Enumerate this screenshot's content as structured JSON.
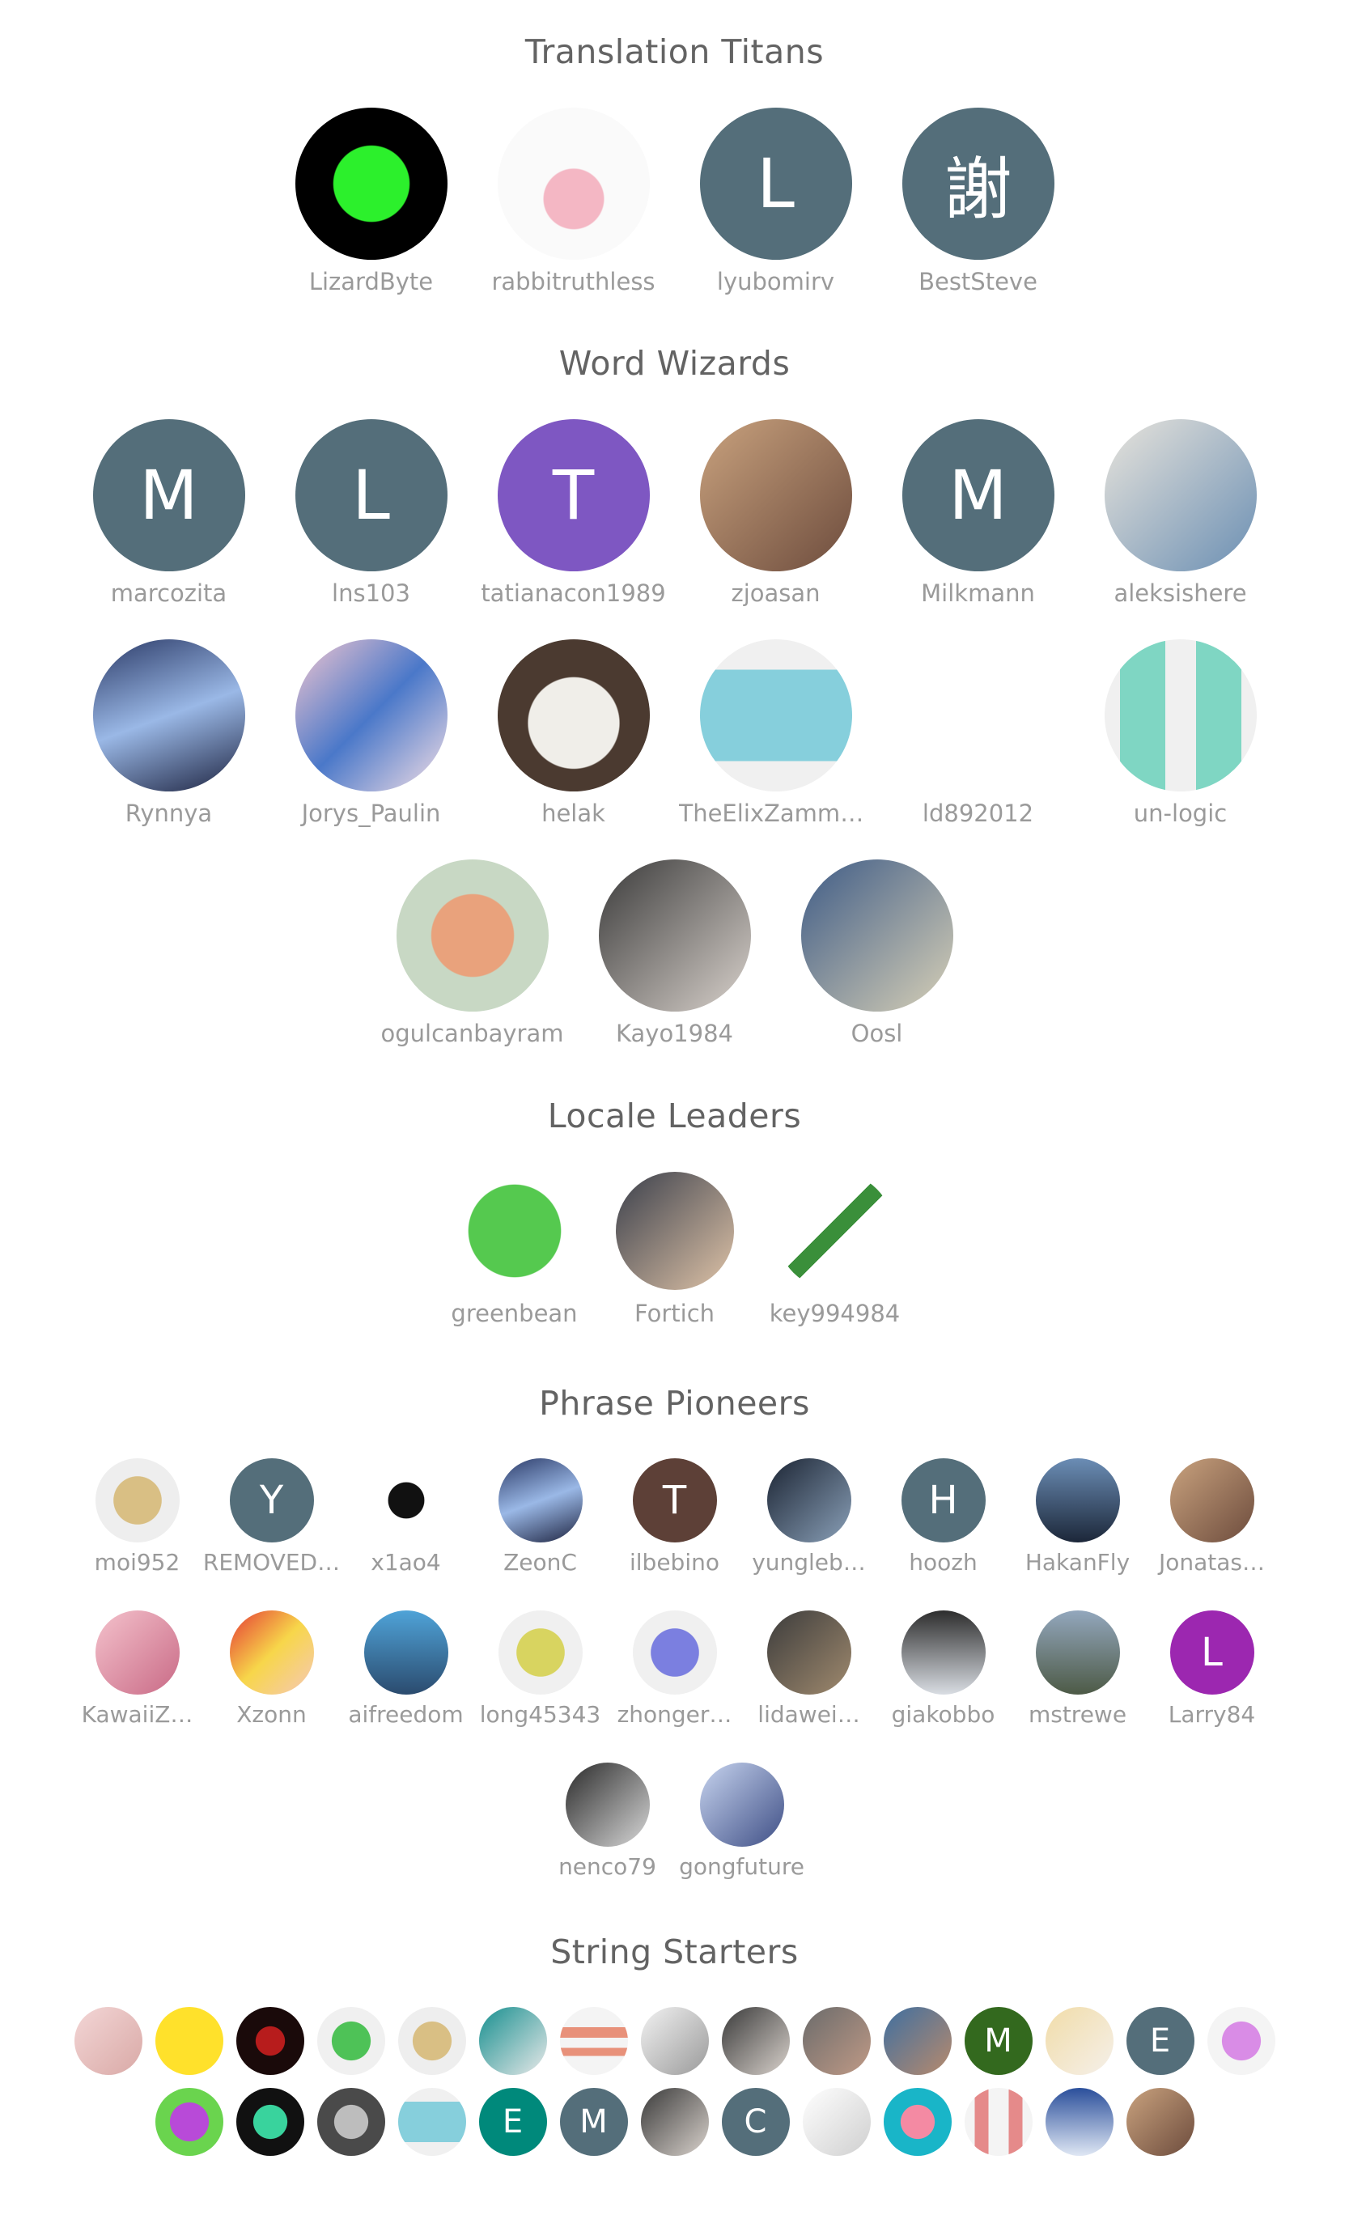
{
  "tiers": [
    {
      "title": "Translation Titans",
      "members": [
        {
          "name": "LizardByte",
          "avatar": "lizard-logo"
        },
        {
          "name": "rabbitruthless",
          "avatar": "rabbit-skull-image"
        },
        {
          "name": "lyubomirv",
          "avatar": "letter",
          "letter": "L",
          "color": "#546e7a"
        },
        {
          "name": "BestSteve",
          "avatar": "letter",
          "letter": "謝",
          "color": "#546e7a"
        }
      ]
    },
    {
      "title": "Word Wizards",
      "members": [
        {
          "name": "marcozita",
          "avatar": "letter",
          "letter": "M",
          "color": "#546e7a"
        },
        {
          "name": "lns103",
          "avatar": "letter",
          "letter": "L",
          "color": "#546e7a"
        },
        {
          "name": "tatianacon1989",
          "avatar": "letter",
          "letter": "T",
          "color": "#7e57c2"
        },
        {
          "name": "zjoasan",
          "avatar": "man-photo"
        },
        {
          "name": "Milkmann",
          "avatar": "letter",
          "letter": "M",
          "color": "#546e7a"
        },
        {
          "name": "aleksishere",
          "avatar": "dog-photo"
        },
        {
          "name": "Rynnya",
          "avatar": "anime-art"
        },
        {
          "name": "Jorys_Paulin",
          "avatar": "cubes-art"
        },
        {
          "name": "helak",
          "avatar": "cat-photo"
        },
        {
          "name": "TheElixZammuto",
          "avatar": "blue-identicon"
        },
        {
          "name": "ld892012",
          "avatar": "blank"
        },
        {
          "name": "un-logic",
          "avatar": "teal-identicon"
        },
        {
          "name": "ogulcanbayram",
          "avatar": "memoji"
        },
        {
          "name": "Kayo1984",
          "avatar": "woman-photo"
        },
        {
          "name": "Oosl",
          "avatar": "landscape-photo"
        }
      ]
    },
    {
      "title": "Locale Leaders",
      "members": [
        {
          "name": "greenbean",
          "avatar": "green-pixel-face"
        },
        {
          "name": "Fortich",
          "avatar": "man-glasses-photo"
        },
        {
          "name": "key994984",
          "avatar": "pencil-image"
        }
      ]
    },
    {
      "title": "Phrase Pioneers",
      "members": [
        {
          "name": "moi952",
          "avatar": "tan-identicon"
        },
        {
          "name": "REMOVED…",
          "avatar": "letter",
          "letter": "Y",
          "color": "#546e7a"
        },
        {
          "name": "x1ao4",
          "avatar": "bowtie-logo"
        },
        {
          "name": "ZeonC",
          "avatar": "anime-art"
        },
        {
          "name": "ilbebino",
          "avatar": "letter",
          "letter": "T",
          "color": "#5d4037"
        },
        {
          "name": "yungleb…",
          "avatar": "dark-art"
        },
        {
          "name": "hoozh",
          "avatar": "letter",
          "letter": "H",
          "color": "#546e7a"
        },
        {
          "name": "HakanFly",
          "avatar": "silhouette-photo"
        },
        {
          "name": "Jonatas…",
          "avatar": "man-photo"
        },
        {
          "name": "KawaiiZ…",
          "avatar": "anime-pink-art"
        },
        {
          "name": "Xzonn",
          "avatar": "anime-red-art"
        },
        {
          "name": "aifreedom",
          "avatar": "beach-photo"
        },
        {
          "name": "long45343",
          "avatar": "yellow-identicon"
        },
        {
          "name": "zhonger…",
          "avatar": "purple-identicon"
        },
        {
          "name": "lidawei…",
          "avatar": "helmet-photo"
        },
        {
          "name": "giakobbo",
          "avatar": "mask-photo"
        },
        {
          "name": "mstrewe",
          "avatar": "mountain-photo"
        },
        {
          "name": "Larry84",
          "avatar": "letter",
          "letter": "L",
          "color": "#9c27b0"
        },
        {
          "name": "nenco79",
          "avatar": "bw-man-photo"
        },
        {
          "name": "gongfuture",
          "avatar": "anime-blue-art"
        }
      ]
    },
    {
      "title": "String Starters",
      "members": [
        {
          "avatar": "pink-photo"
        },
        {
          "avatar": "smiley-face"
        },
        {
          "avatar": "red-emblem"
        },
        {
          "avatar": "green-identicon"
        },
        {
          "avatar": "tan-identicon"
        },
        {
          "avatar": "pixel-art"
        },
        {
          "avatar": "salmon-identicon"
        },
        {
          "avatar": "anime-white-art"
        },
        {
          "avatar": "woman-photo"
        },
        {
          "avatar": "bald-man-photo"
        },
        {
          "avatar": "man-beard-photo"
        },
        {
          "avatar": "letter",
          "letter": "M",
          "color": "#33691e"
        },
        {
          "avatar": "anime-blonde-art"
        },
        {
          "avatar": "letter",
          "letter": "E",
          "color": "#546e7a"
        },
        {
          "avatar": "magenta-identicon"
        },
        {
          "avatar": "lion-logo"
        },
        {
          "avatar": "wolf-logo"
        },
        {
          "avatar": "apple-logo"
        },
        {
          "avatar": "blue-identicon"
        },
        {
          "avatar": "letter",
          "letter": "E",
          "color": "#00897b"
        },
        {
          "avatar": "letter",
          "letter": "M",
          "color": "#546e7a"
        },
        {
          "avatar": "woman-photo"
        },
        {
          "avatar": "letter",
          "letter": "C",
          "color": "#546e7a"
        },
        {
          "avatar": "sketch-art"
        },
        {
          "avatar": "pink-bird-logo"
        },
        {
          "avatar": "red-identicon"
        },
        {
          "avatar": "anime-hat-art"
        },
        {
          "avatar": "man-photo"
        }
      ]
    }
  ]
}
